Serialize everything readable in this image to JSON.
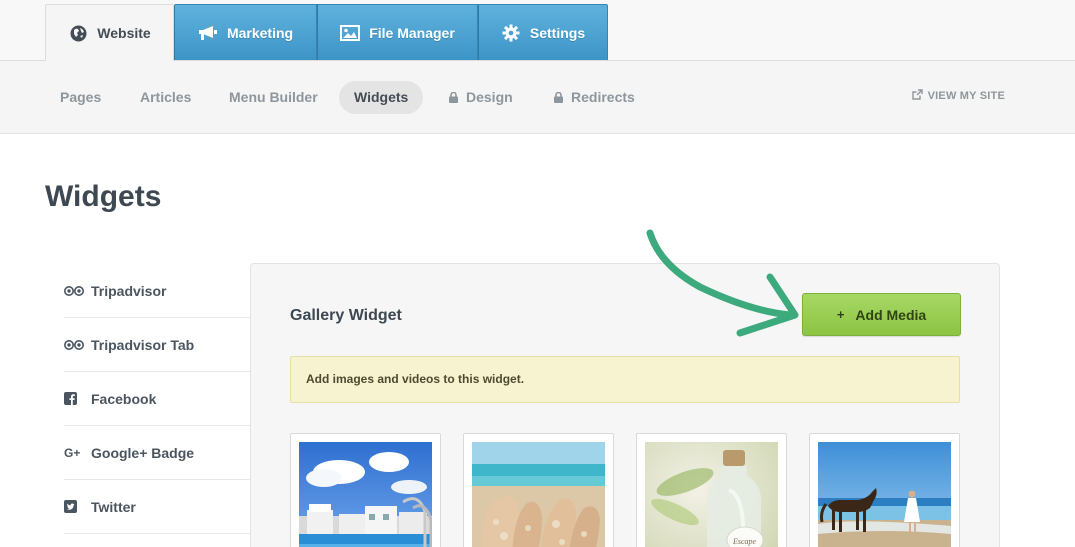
{
  "main_tabs": [
    {
      "label": "Website",
      "icon": "globe-icon",
      "active": true
    },
    {
      "label": "Marketing",
      "icon": "megaphone-icon",
      "active": false
    },
    {
      "label": "File Manager",
      "icon": "image-icon",
      "active": false
    },
    {
      "label": "Settings",
      "icon": "gear-icon",
      "active": false
    }
  ],
  "sub_nav": {
    "items": [
      {
        "label": "Pages",
        "locked": false,
        "active": false
      },
      {
        "label": "Articles",
        "locked": false,
        "active": false
      },
      {
        "label": "Menu Builder",
        "locked": false,
        "active": false
      },
      {
        "label": "Widgets",
        "locked": false,
        "active": true
      },
      {
        "label": "Design",
        "locked": true,
        "active": false
      },
      {
        "label": "Redirects",
        "locked": true,
        "active": false
      }
    ],
    "view_site": "VIEW MY SITE"
  },
  "page": {
    "title": "Widgets"
  },
  "widget_list": [
    {
      "label": "Tripadvisor",
      "icon": "tripadvisor-icon"
    },
    {
      "label": "Tripadvisor Tab",
      "icon": "tripadvisor-icon"
    },
    {
      "label": "Facebook",
      "icon": "facebook-icon"
    },
    {
      "label": "Google+ Badge",
      "icon": "google-plus-icon"
    },
    {
      "label": "Twitter",
      "icon": "twitter-icon"
    }
  ],
  "gallery": {
    "title": "Gallery Widget",
    "add_button": {
      "plus": "+",
      "label": "Add Media"
    },
    "notice": "Add images and videos to this widget.",
    "thumbnails": [
      {
        "scene": "resort-pool"
      },
      {
        "scene": "sandy-feet"
      },
      {
        "scene": "message-bottle"
      },
      {
        "scene": "beach-horse"
      }
    ]
  },
  "colors": {
    "tab_blue": "#4aa3d3",
    "button_green": "#9bcf52",
    "notice_yellow": "#f7f2cf",
    "arrow_green": "#3daa7d",
    "title_text": "#3d4852"
  }
}
